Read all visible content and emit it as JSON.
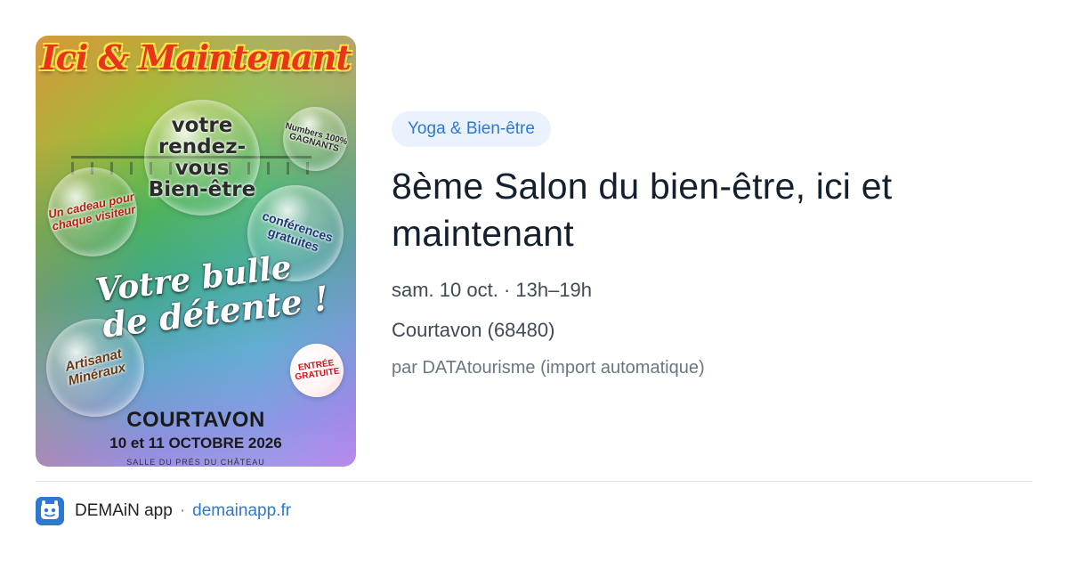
{
  "poster": {
    "title": "Ici & Maintenant",
    "bubble_rdv": "votre rendez-vous Bien-être",
    "bubble_numbers": "Numbers 100% GAGNANTS",
    "bubble_gift": "Un cadeau pour chaque visiteur",
    "bubble_conferences": "conférences gratuites",
    "tagline_1": "Votre bulle",
    "tagline_2": "de détente !",
    "bubble_crafts": "Artisanat Minéraux",
    "bubble_entry": "ENTRÉE GRATUITE",
    "city": "COURTAVON",
    "dates": "10 et 11 OCTOBRE 2026",
    "venue": "SALLE DU PRÉS DU CHÂTEAU"
  },
  "event": {
    "category": "Yoga & Bien-être",
    "title": "8ème Salon du bien-être, ici et maintenant",
    "datetime": "sam. 10 oct. · 13h–19h",
    "location": "Courtavon (68480)",
    "organizer": "par DATAtourisme (import automatique)"
  },
  "footer": {
    "app_name": "DEMAiN app",
    "separator": "·",
    "domain": "demainapp.fr"
  },
  "colors": {
    "accent": "#2f78d1",
    "tag_bg": "#eaf2fd",
    "title": "#14202e",
    "meta": "#3f4a57"
  }
}
